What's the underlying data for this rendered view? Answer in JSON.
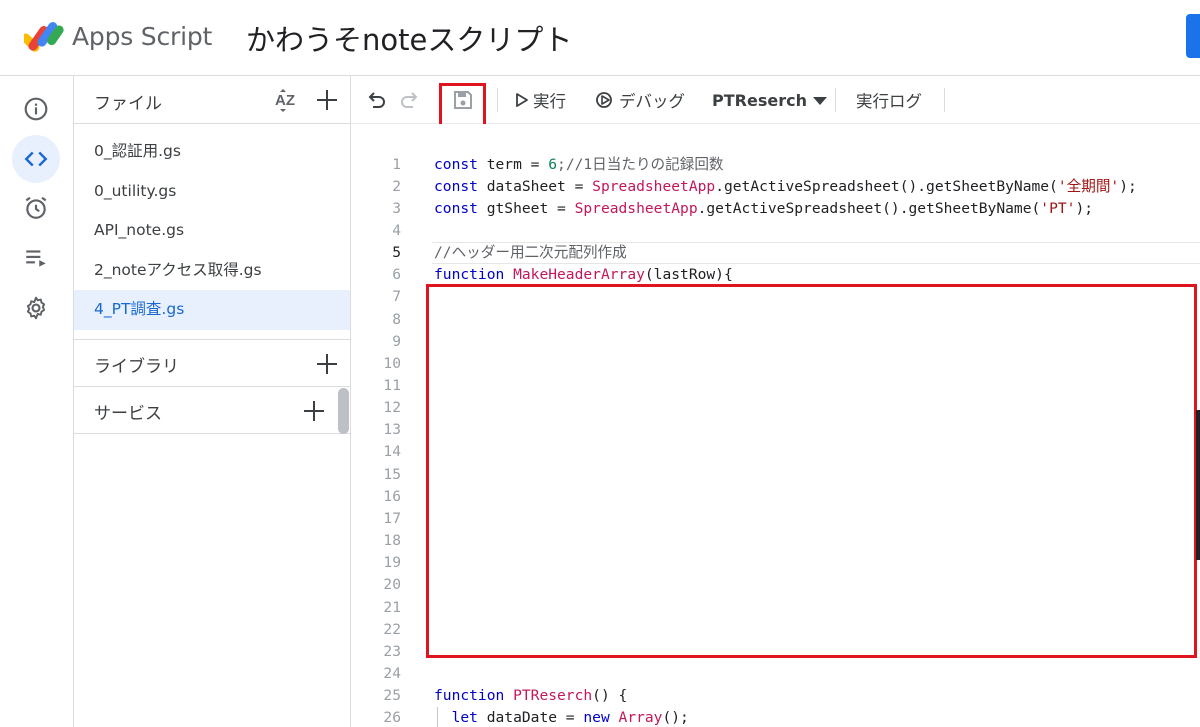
{
  "header": {
    "app_name": "Apps Script",
    "project_title": "かわうそnoteスクリプト"
  },
  "rail": {
    "items": [
      "overview-icon",
      "editor-icon",
      "triggers-icon",
      "executions-icon",
      "settings-icon"
    ],
    "active_index": 1
  },
  "files_panel": {
    "title": "ファイル",
    "files": [
      "0_認証用.gs",
      "0_utility.gs",
      "API_note.gs",
      "2_noteアクセス取得.gs",
      "4_PT調査.gs"
    ],
    "active_file": "4_PT調査.gs",
    "libraries_label": "ライブラリ",
    "services_label": "サービス"
  },
  "toolbar": {
    "run_label": "実行",
    "debug_label": "デバッグ",
    "function_name": "PTReserch",
    "log_label": "実行ログ"
  },
  "editor": {
    "current_line": 5,
    "line_numbers": [
      "1",
      "2",
      "3",
      "4",
      "5",
      "6",
      "7",
      "8",
      "9",
      "10",
      "11",
      "12",
      "13",
      "14",
      "15",
      "16",
      "17",
      "18",
      "19",
      "20",
      "21",
      "22",
      "23",
      "24",
      "25",
      "26"
    ],
    "code": {
      "l1": [
        {
          "t": "const",
          "c": "kw"
        },
        {
          "t": " term = ",
          "c": ""
        },
        {
          "t": "6",
          "c": "num"
        },
        {
          "t": ";//1日当たりの記録回数",
          "c": "cmt"
        }
      ],
      "l2": [
        {
          "t": "const",
          "c": "kw"
        },
        {
          "t": " dataSheet = ",
          "c": ""
        },
        {
          "t": "SpreadsheetApp",
          "c": "cls"
        },
        {
          "t": ".getActiveSpreadsheet().getSheetByName(",
          "c": ""
        },
        {
          "t": "'全期間'",
          "c": "str"
        },
        {
          "t": ");",
          "c": ""
        }
      ],
      "l3": [
        {
          "t": "const",
          "c": "kw"
        },
        {
          "t": " gtSheet = ",
          "c": ""
        },
        {
          "t": "SpreadsheetApp",
          "c": "cls"
        },
        {
          "t": ".getActiveSpreadsheet().getSheetByName(",
          "c": ""
        },
        {
          "t": "'PT'",
          "c": "str"
        },
        {
          "t": ");",
          "c": ""
        }
      ],
      "l5": [
        {
          "t": "//ヘッダー用二次元配列作成",
          "c": "cmt"
        }
      ],
      "l6": [
        {
          "t": "function",
          "c": "kw"
        },
        {
          "t": " ",
          "c": ""
        },
        {
          "t": "MakeHeaderArray",
          "c": "fn"
        },
        {
          "t": "(lastRow){",
          "c": ""
        }
      ],
      "l25": [
        {
          "t": "function",
          "c": "kw"
        },
        {
          "t": " ",
          "c": ""
        },
        {
          "t": "PTReserch",
          "c": "fn"
        },
        {
          "t": "() {",
          "c": ""
        }
      ],
      "l26": [
        {
          "t": "  let",
          "c": "kw"
        },
        {
          "t": " dataDate = ",
          "c": ""
        },
        {
          "t": "new",
          "c": "kw"
        },
        {
          "t": " ",
          "c": ""
        },
        {
          "t": "Array",
          "c": "fn"
        },
        {
          "t": "();",
          "c": ""
        }
      ]
    }
  },
  "colors": {
    "accent": "#1a73e8",
    "active_bg": "#e8f0fe",
    "highlight_red": "#e0141f"
  }
}
